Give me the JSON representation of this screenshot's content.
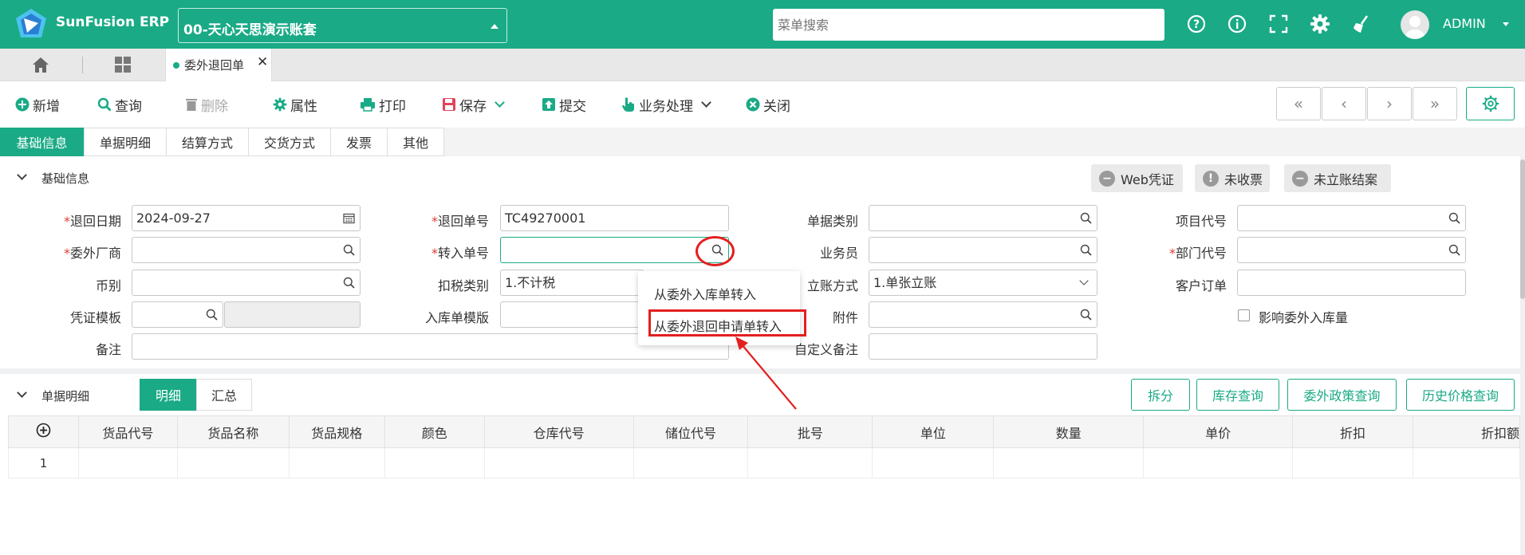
{
  "app": {
    "name": "SunFusion ERP",
    "account": "00-天心天思演示账套",
    "search_placeholder": "菜单搜索",
    "user": "ADMIN"
  },
  "tabs": {
    "doc_tab": "委外退回单"
  },
  "toolbar": {
    "new": "新增",
    "query": "查询",
    "delete": "删除",
    "properties": "属性",
    "print": "打印",
    "save": "保存",
    "submit": "提交",
    "business": "业务处理",
    "close": "关闭"
  },
  "section_tabs": [
    "基础信息",
    "单据明细",
    "结算方式",
    "交货方式",
    "发票",
    "其他"
  ],
  "basic": {
    "title": "基础信息",
    "status": {
      "web_voucher": "Web凭证",
      "no_invoice": "未收票",
      "no_settle": "未立账结案"
    },
    "labels": {
      "return_date": "退回日期",
      "vendor": "委外厂商",
      "currency": "币别",
      "voucher_tpl": "凭证模板",
      "remark": "备注",
      "return_no": "退回单号",
      "transfer_no": "转入单号",
      "tax_type": "扣税类别",
      "stockin_tpl": "入库单模版",
      "doc_type": "单据类别",
      "salesman": "业务员",
      "account_method": "立账方式",
      "attachment": "附件",
      "custom_remark": "自定义备注",
      "project_code": "项目代号",
      "dept_code": "部门代号",
      "customer_order": "客户订单",
      "affect_qty": "影响委外入库量"
    },
    "required_mark": "*",
    "values": {
      "return_date": "2024-09-27",
      "return_no": "TC49270001",
      "tax_type": "1.不计税",
      "account_method": "1.单张立账"
    }
  },
  "dropdown": {
    "items": [
      "从委外入库单转入",
      "从委外退回申请单转入"
    ]
  },
  "detail": {
    "title": "单据明细",
    "view_tabs": [
      "明细",
      "汇总"
    ],
    "actions": [
      "拆分",
      "库存查询",
      "委外政策查询",
      "历史价格查询"
    ],
    "columns": [
      "货品代号",
      "货品名称",
      "货品规格",
      "颜色",
      "仓库代号",
      "储位代号",
      "批号",
      "单位",
      "数量",
      "单价",
      "折扣",
      "折扣额"
    ],
    "rows": [
      [
        "1",
        "",
        "",
        "",
        "",
        "",
        "",
        "",
        "",
        "",
        "",
        "",
        ""
      ]
    ]
  },
  "colors": {
    "brand": "#1aaa86",
    "annotation": "#e41f1f"
  }
}
